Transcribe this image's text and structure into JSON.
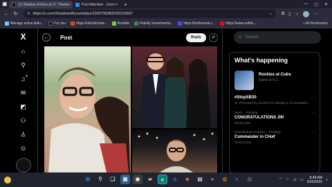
{
  "browser": {
    "tabs": [
      {
        "label": "(1) Shadow of Ezra on X: \"Huma",
        "favicon_color": "#111111",
        "active": true
      },
      {
        "label": "Post Attendee - Zoom",
        "favicon_color": "#2d8cff",
        "active": false
      }
    ],
    "url": "https://x.com/ShadowofEzra/status/1926799383225315567",
    "bookmarks": [
      {
        "label": "Manage active listin...",
        "icon_color": "#7cc4ff"
      },
      {
        "label": "For you",
        "icon_color": "#111111"
      },
      {
        "label": "https://old.bitchute...",
        "icon_color": "#e0452c"
      },
      {
        "label": "Rumble",
        "icon_color": "#85c742"
      },
      {
        "label": "Fidelity Investments...",
        "icon_color": "#3a8a3a"
      },
      {
        "label": "https://truthsocial.c...",
        "icon_color": "#5448ee"
      },
      {
        "label": "https://www.netflix....",
        "icon_color": "#e50914"
      }
    ],
    "bookmarks_more": "»  All Bookmarks"
  },
  "x_sidebar": {
    "logo": "X",
    "icons": [
      "home-icon",
      "search-icon",
      "notifications-icon",
      "messages-icon",
      "grok-icon",
      "communities-icon",
      "profile-icon",
      "more-icon"
    ]
  },
  "post": {
    "back_glyph": "←",
    "title": "Post",
    "reply_label": "Reply"
  },
  "right": {
    "search_placeholder": "Search",
    "happening_title": "What's happening",
    "sport": {
      "name": "Rockies at Cubs",
      "time": "Starts at 6:2..."
    },
    "trends": [
      {
        "context": "",
        "name": "#StopSB30",
        "meta": "Promoted by Citizens for Integrity & Accountability",
        "promoted": true
      },
      {
        "context": "Music · Trending",
        "name": "CONGRATULATIONS JIN",
        "meta": "58.5K posts",
        "promoted": false
      },
      {
        "context": "Entertainment industry · Trending",
        "name": "Commander in Chief",
        "meta": "18.6K posts",
        "promoted": false
      }
    ]
  },
  "taskbar": {
    "time": "8:48 AM",
    "date": "5/25/2025"
  },
  "colors": {
    "accent": "#1d9bf0",
    "background": "#000000"
  }
}
